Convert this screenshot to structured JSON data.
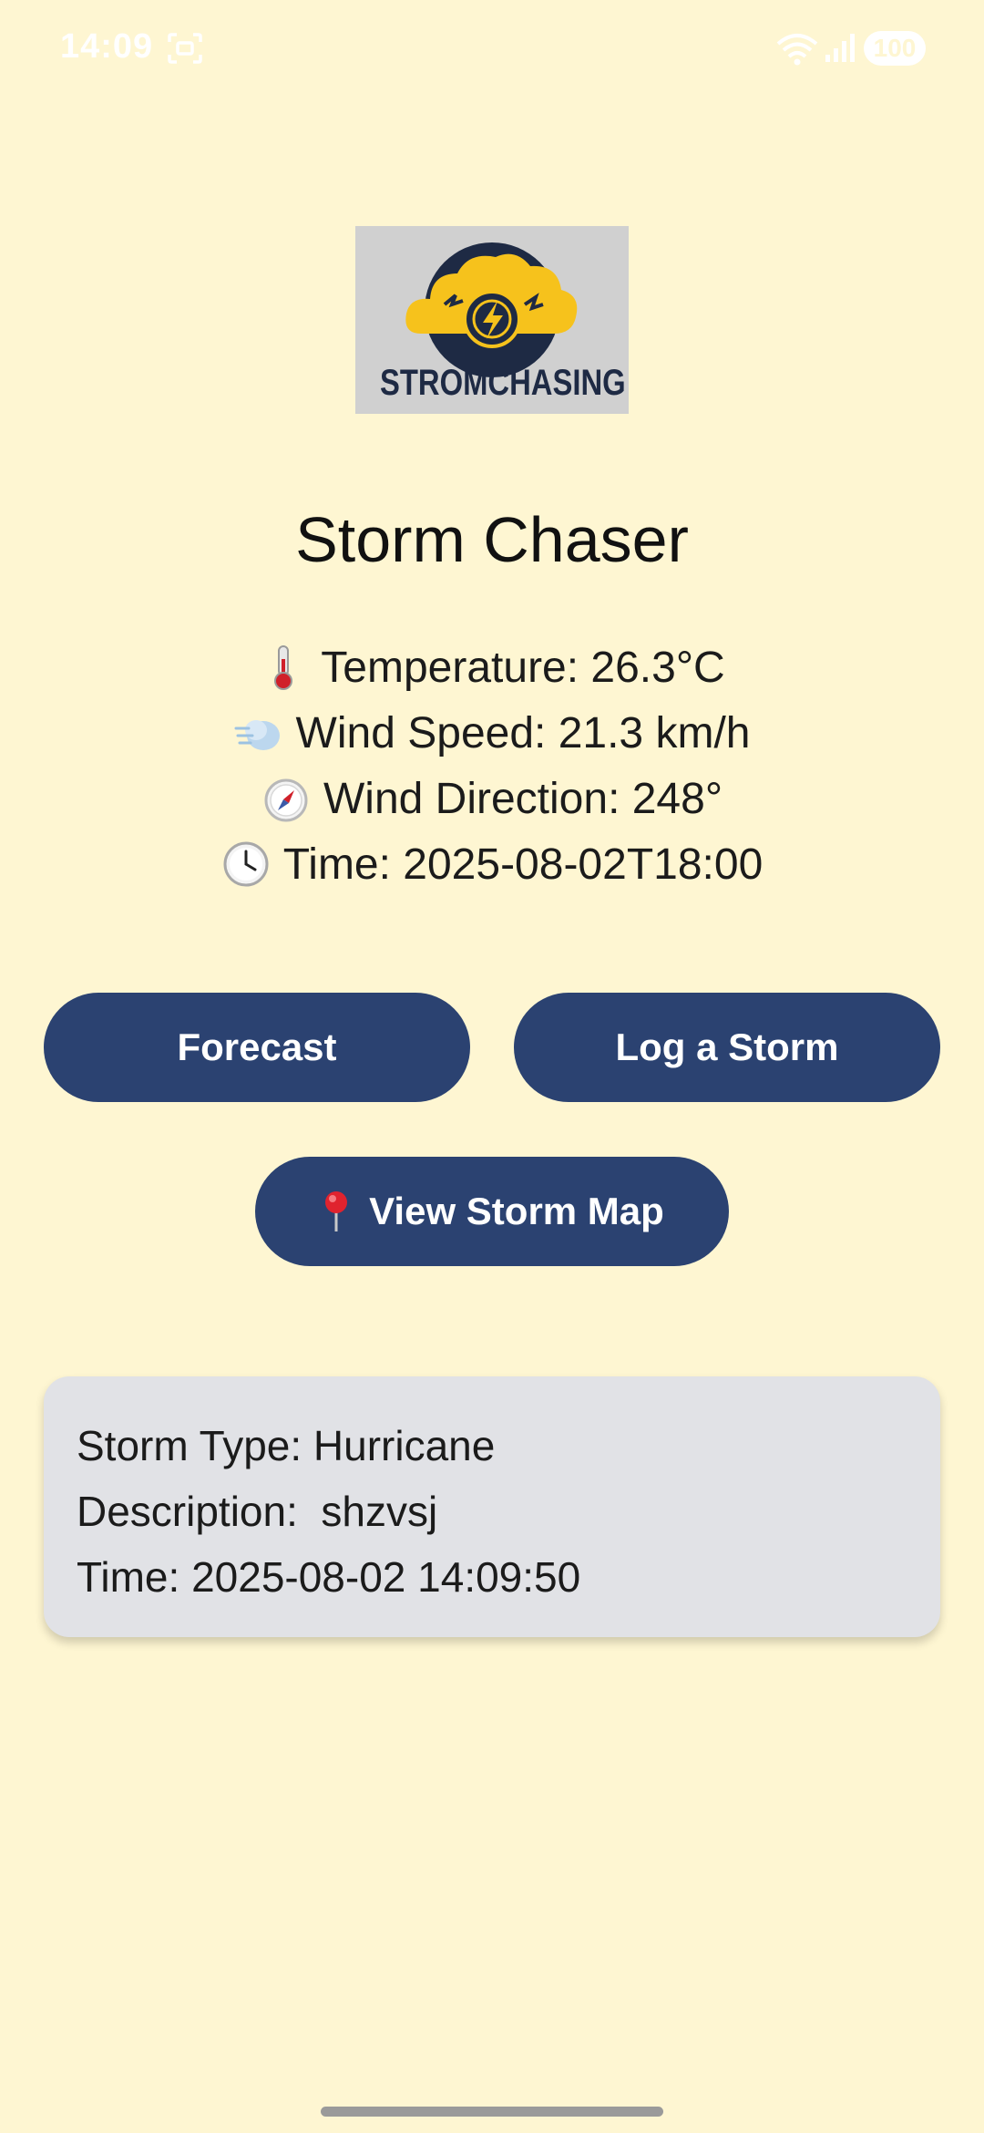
{
  "status_bar": {
    "time": "14:09",
    "battery": "100"
  },
  "logo": {
    "text": "STROMCHASING"
  },
  "app": {
    "title": "Storm Chaser"
  },
  "weather": {
    "temperature": "Temperature: 26.3°C",
    "wind_speed": "Wind Speed: 21.3 km/h",
    "wind_direction": "Wind Direction: 248°",
    "time": "Time: 2025-08-02T18:00"
  },
  "buttons": {
    "forecast": "Forecast",
    "log_storm": "Log a Storm",
    "view_map": "View Storm Map"
  },
  "storm_card": {
    "type": "Storm Type: Hurricane",
    "description": "Description:  shzvsj",
    "time": "Time: 2025-08-02 14:09:50"
  },
  "colors": {
    "background": "#FEF6D2",
    "button": "#2B4271",
    "card": "#E1E2E6"
  }
}
